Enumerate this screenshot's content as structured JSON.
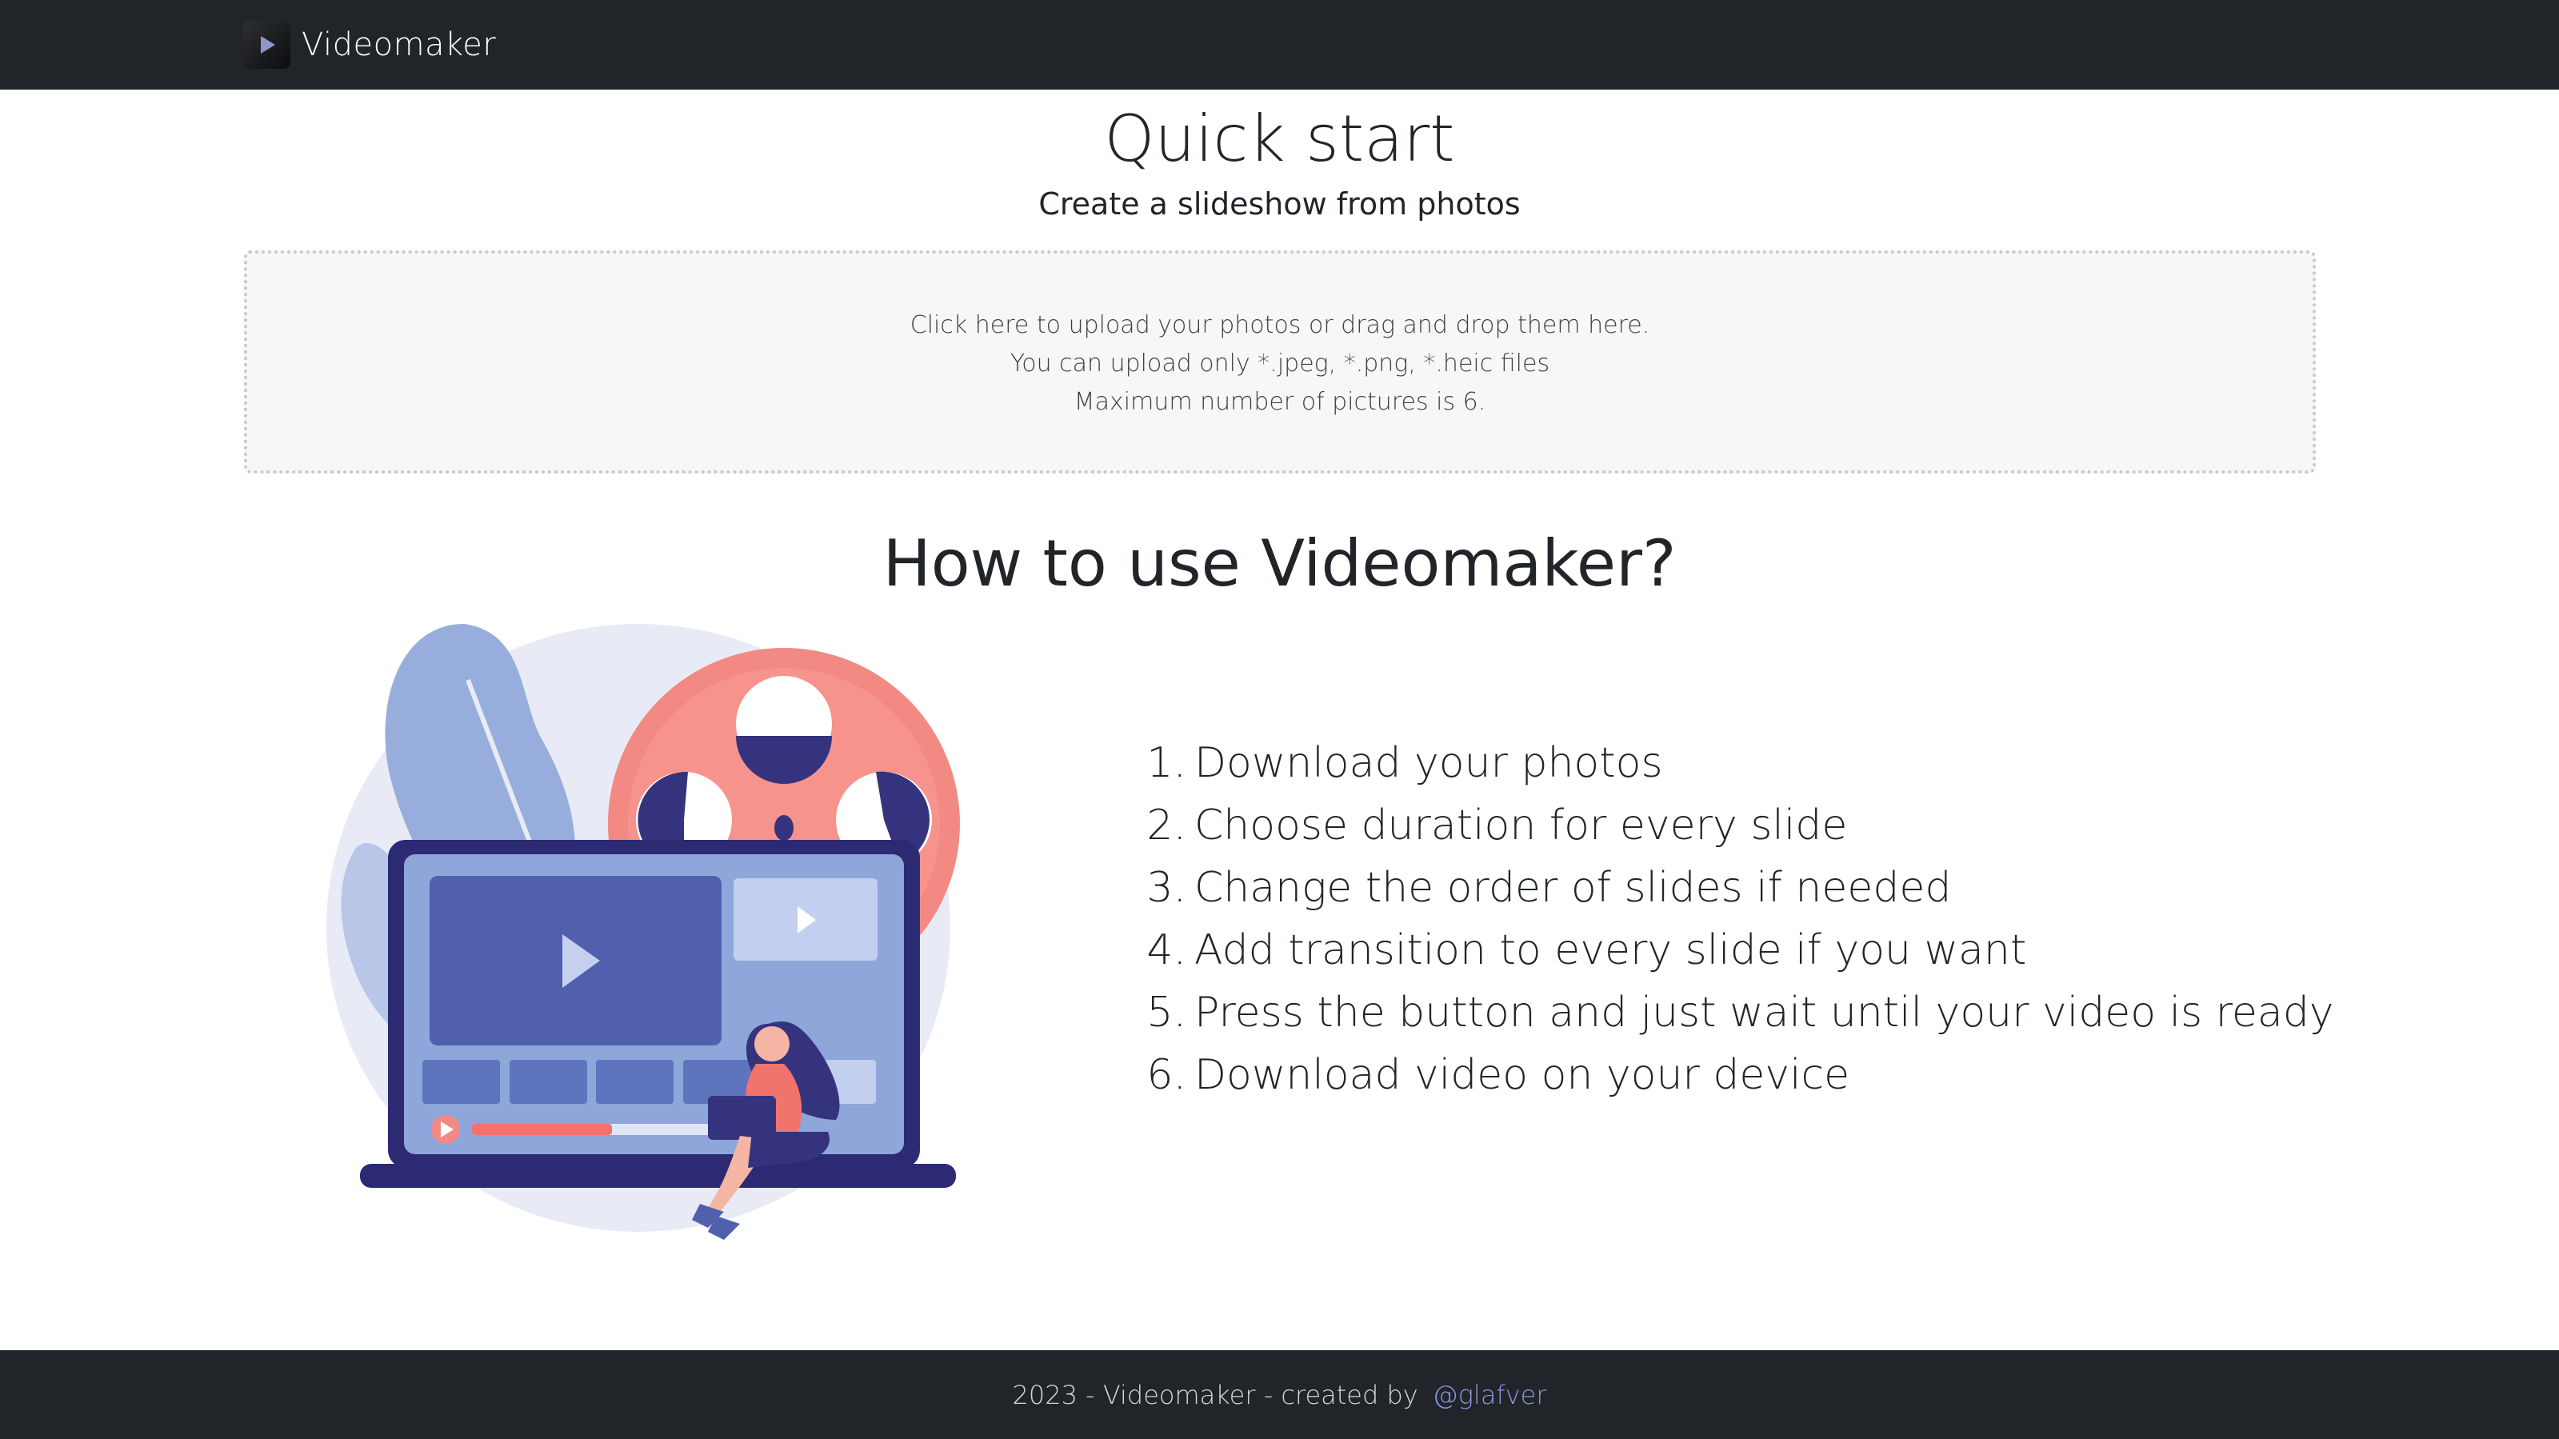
{
  "navbar": {
    "brand": "Videomaker",
    "brand_icon": "play-icon"
  },
  "hero": {
    "title": "Quick start",
    "subtitle": "Create a slideshow from photos"
  },
  "upload": {
    "line1": "Click here to upload your photos or drag and drop them here.",
    "line2": "You can upload only *.jpeg, *.png, *.heic files",
    "line3": "Maximum number of pictures is 6."
  },
  "how_to": {
    "title": "How to use Videomaker?",
    "illustration_icon": "video-editing-illustration",
    "steps": [
      {
        "num": "1.",
        "text": "Download your photos"
      },
      {
        "num": "2.",
        "text": "Choose duration for every slide"
      },
      {
        "num": "3.",
        "text": "Change the order of slides if needed"
      },
      {
        "num": "4.",
        "text": "Add transition to every slide if you want"
      },
      {
        "num": "5.",
        "text": "Press the button and just wait until your video is ready"
      },
      {
        "num": "6.",
        "text": "Download video on your device"
      }
    ]
  },
  "footer": {
    "text": "2023 - Videomaker - created by",
    "link": "@glafver"
  },
  "colors": {
    "nav_bg": "#212529",
    "accent_link": "#8a97e0",
    "reel": "#f28a83",
    "screen_blue": "#5060ad"
  }
}
